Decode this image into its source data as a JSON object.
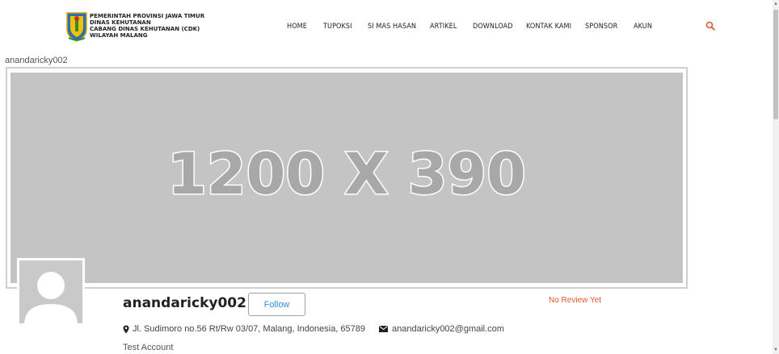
{
  "header": {
    "logo_lines": [
      "PEMERINTAH PROVINSI JAWA TIMUR",
      "DINAS KEHUTANAN",
      "CABANG DINAS KEHUTANAN (CDK)",
      "WILAYAH MALANG"
    ],
    "nav": [
      "HOME",
      "TUPOKSI",
      "SI MAS HASAN",
      "ARTIKEL",
      "DOWNLOAD",
      "KONTAK KAMI",
      "SPONSOR",
      "AKUN"
    ],
    "search_icon": "search-icon",
    "accent_color": "#e4572e"
  },
  "breadcrumb": {
    "username": "anandaricky002"
  },
  "cover": {
    "placeholder_text": "1200 X 390"
  },
  "profile": {
    "username": "anandaricky002",
    "follow_label": "Follow",
    "review_status": "No Review Yet",
    "address": "Jl. Sudimoro no.56 Rt/Rw 03/07, Malang, Indonesia, 65789",
    "email": "anandaricky002@gmail.com",
    "bio": "Test Account"
  }
}
